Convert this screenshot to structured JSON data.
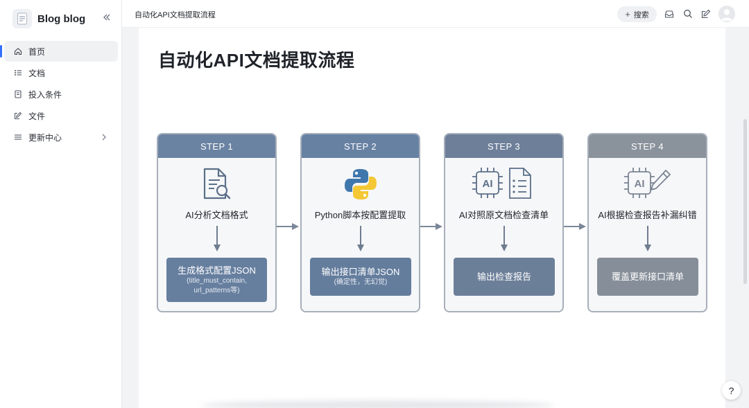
{
  "app": {
    "name": "Blog blog"
  },
  "sidebar": {
    "items": [
      {
        "label": "首页",
        "icon": "home-icon",
        "active": true
      },
      {
        "label": "文档",
        "icon": "list-icon",
        "active": false
      },
      {
        "label": "投入条件",
        "icon": "document-icon",
        "active": false
      },
      {
        "label": "文件",
        "icon": "edit-icon",
        "active": false
      },
      {
        "label": "更新中心",
        "icon": "menu-icon",
        "active": false,
        "has_children": true
      }
    ]
  },
  "topbar": {
    "doc_title": "自动化API文档提取流程",
    "search_label": "搜索",
    "icons": [
      "inbox-icon",
      "search-icon",
      "edit-icon",
      "avatar"
    ]
  },
  "main": {
    "title": "自动化API文档提取流程",
    "steps": [
      {
        "header": "STEP 1",
        "icon": "document-search-icon",
        "label": "AI分析文档格式",
        "output_main": "生成格式配置JSON",
        "output_sub1": "(title_must_contain,",
        "output_sub2": "url_patterns等)"
      },
      {
        "header": "STEP 2",
        "icon": "python-logo",
        "label": "Python脚本按配置提取",
        "output_main": "输出接口清单JSON",
        "output_sub1": "(确定性，无幻觉)"
      },
      {
        "header": "STEP 3",
        "icon": "ai-chip-and-checklist-icon",
        "label": "AI对照原文档检查清单",
        "output_main": "输出检查报告"
      },
      {
        "header": "STEP 4",
        "icon": "ai-chip-and-pencil-icon",
        "label": "AI根据检查报告补漏纠错",
        "output_main": "覆盖更新接口清单"
      }
    ]
  },
  "help": {
    "label": "?"
  },
  "colors": {
    "step1_head": "#6b83a2",
    "step2_head": "#6781a3",
    "step3_head": "#6d7f99",
    "step4_head": "#8a929c",
    "step1_out": "#677f9f",
    "step2_out": "#647d9d",
    "step3_out": "#6c7f99",
    "step4_out": "#868f99",
    "arrow": "#7a8799"
  }
}
